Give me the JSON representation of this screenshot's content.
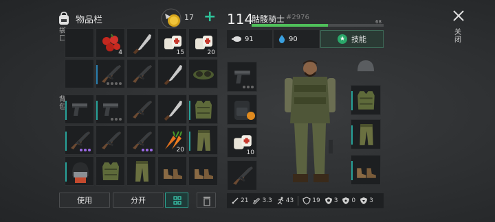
{
  "inventory": {
    "title": "物品栏",
    "coins": "17",
    "plus": "+",
    "equip_label": "袋口",
    "backpack_label": "背包",
    "slots_pocket": [
      {
        "icon": "empty-slot"
      },
      {
        "icon": "berries-icon",
        "count": "4"
      },
      {
        "icon": "machete-icon",
        "count": ""
      },
      {
        "icon": "bandage-icon",
        "count": "15"
      },
      {
        "icon": "bandage-icon",
        "count": "20"
      },
      {
        "icon": "empty-slot"
      },
      {
        "icon": "rifle-icon",
        "count": ""
      },
      {
        "icon": "rifle-icon",
        "count": ""
      },
      {
        "icon": "machete-icon",
        "count": ""
      },
      {
        "icon": "goggles-icon",
        "count": ""
      }
    ],
    "slots_backpack": [
      {
        "icon": "pistol-icon"
      },
      {
        "icon": "pistol-icon"
      },
      {
        "icon": "rifle-icon"
      },
      {
        "icon": "machete-icon"
      },
      {
        "icon": "vest-icon"
      },
      {
        "icon": "rifle-icon"
      },
      {
        "icon": "rifle-icon"
      },
      {
        "icon": "rifle-icon"
      },
      {
        "icon": "carrot-icon",
        "count": "20"
      },
      {
        "icon": "pants-icon"
      },
      {
        "icon": "helmet-icon"
      },
      {
        "icon": "vest-icon"
      },
      {
        "icon": "pants-icon"
      },
      {
        "icon": "boots-icon"
      },
      {
        "icon": "boots-icon"
      }
    ],
    "buttons": {
      "use": "使用",
      "split": "分开"
    }
  },
  "character": {
    "level": "114",
    "name": "骷髅骑士",
    "id": "#2976",
    "xp_value": "68",
    "xp_fraction": 0.58,
    "food": "91",
    "water": "90",
    "skill_label": "技能",
    "bandage_count": "10"
  },
  "stats": [
    {
      "icon": "sword-icon",
      "value": "21"
    },
    {
      "icon": "speed-icon",
      "value": "3.3"
    },
    {
      "icon": "run-icon",
      "value": "43"
    },
    {
      "icon": "shield-icon",
      "value": "19"
    },
    {
      "icon": "skull-shield-icon",
      "value": "3"
    },
    {
      "icon": "radiation-shield-icon",
      "value": "0"
    },
    {
      "icon": "bio-shield-icon",
      "value": "3"
    }
  ],
  "close_label": "关闭",
  "colors": {
    "accent": "#2ec39a",
    "xp": "#4fbf5a",
    "rarity_purple": "#9d6be6"
  }
}
